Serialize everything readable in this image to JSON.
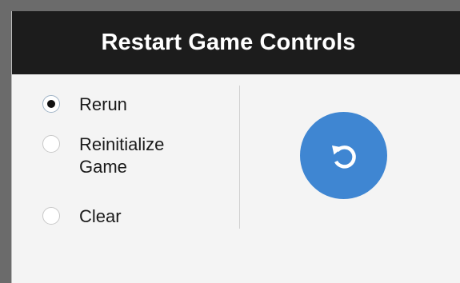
{
  "dialog": {
    "title": "Restart Game Controls"
  },
  "options": [
    {
      "label": "Rerun",
      "selected": true
    },
    {
      "label": "Reinitialize Game",
      "selected": false
    },
    {
      "label": "Clear",
      "selected": false
    }
  ],
  "restart_button": {
    "icon": "restart-icon",
    "color": "#3f86d2"
  },
  "colors": {
    "header_bg": "#1c1c1c",
    "body_bg": "#f4f4f4",
    "accent": "#3f86d2"
  }
}
